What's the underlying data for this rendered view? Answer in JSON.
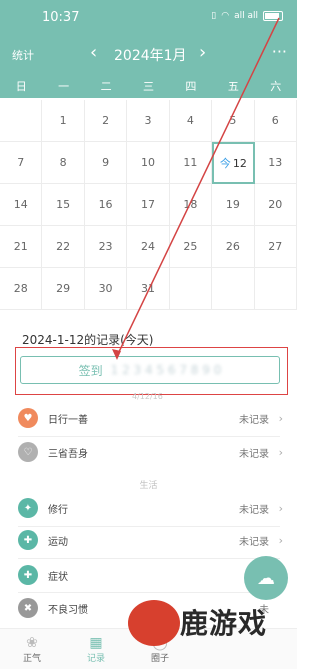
{
  "status_bar": {
    "time": "10:37",
    "signal": "all all"
  },
  "header": {
    "stats_label": "统计",
    "prev": "‹",
    "month": "2024年1月",
    "next": "›",
    "more": "···"
  },
  "weekdays": [
    "日",
    "一",
    "二",
    "三",
    "四",
    "五",
    "六"
  ],
  "calendar": {
    "rows": [
      [
        "",
        "1",
        "2",
        "3",
        "4",
        "5",
        "6"
      ],
      [
        "7",
        "8",
        "9",
        "10",
        "11",
        "12",
        "13"
      ],
      [
        "14",
        "15",
        "16",
        "17",
        "18",
        "19",
        "20"
      ],
      [
        "21",
        "22",
        "23",
        "24",
        "25",
        "26",
        "27"
      ],
      [
        "28",
        "29",
        "30",
        "31",
        "",
        "",
        ""
      ]
    ],
    "today_tag": "今"
  },
  "record": {
    "title": "2024-1-12的记录(今天)",
    "sign_label": "签到",
    "sign_blur": "1 2 3 4 5 6 7 8 9 0",
    "sign_sub": "4/12/16"
  },
  "items_top": [
    {
      "label": "日行一善",
      "value": "未记录",
      "color": "#f08a5d"
    },
    {
      "label": "三省吾身",
      "value": "未记录",
      "color": "#b0b0b0"
    }
  ],
  "section_label": "生活",
  "items_bottom": [
    {
      "label": "修行",
      "value": "未记录",
      "color": "#5bb7a6"
    },
    {
      "label": "运动",
      "value": "未记录",
      "color": "#5bb7a6"
    },
    {
      "label": "症状",
      "value": "未",
      "color": "#5bb7a6"
    },
    {
      "label": "不良习惯",
      "value": "未",
      "color": "#999999"
    }
  ],
  "fab_icon": "cloud-icon",
  "tabs": [
    {
      "label": "正气",
      "icon": "lotus-icon"
    },
    {
      "label": "记录",
      "icon": "calendar-icon",
      "active": true
    },
    {
      "label": "圈子",
      "icon": "circle-icon"
    }
  ],
  "watermark": {
    "text": "鹿游戏",
    "url": "www.luyxcn"
  },
  "colors": {
    "accent": "#78bfb1",
    "highlight": "#d44444"
  }
}
